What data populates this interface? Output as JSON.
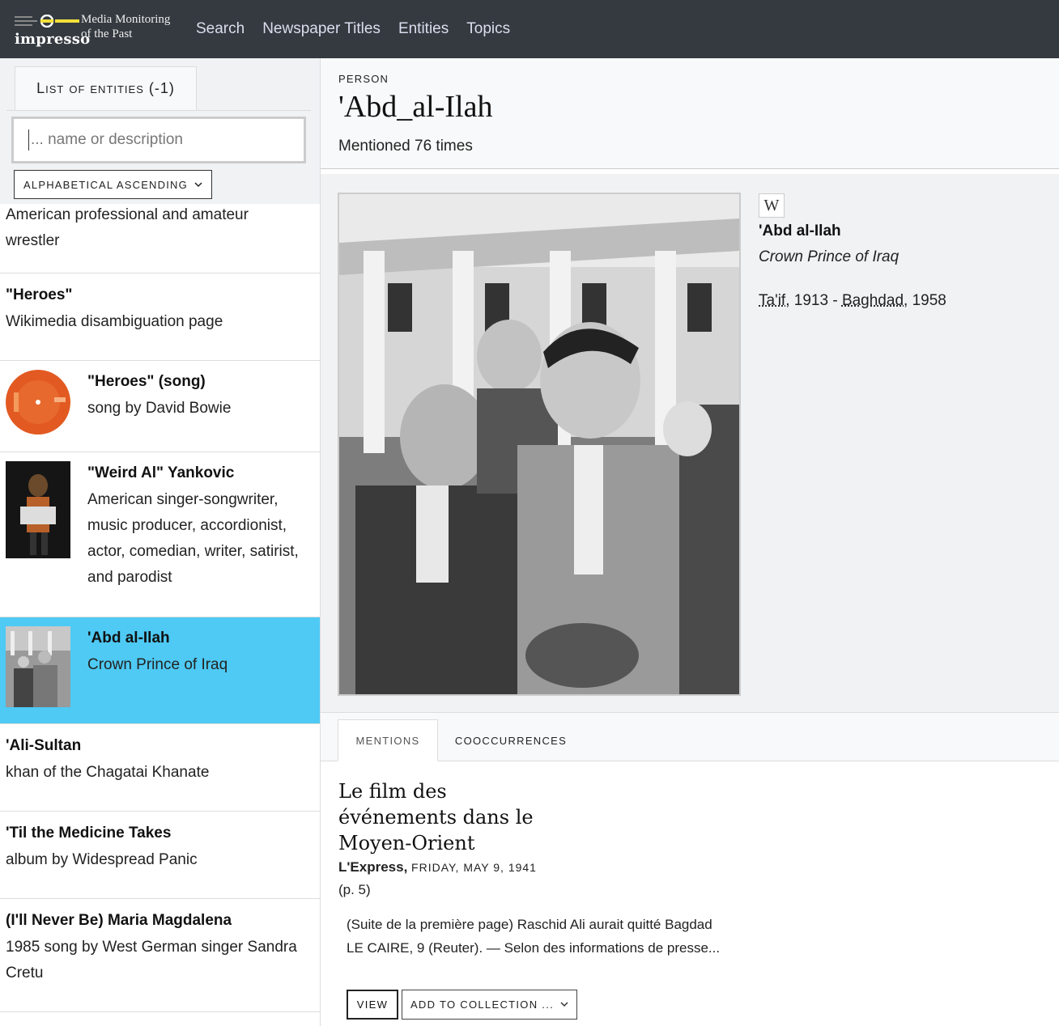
{
  "nav": {
    "brand_word": "impresso",
    "brand_tag_line1": "Media Monitoring",
    "brand_tag_line2": "of the Past",
    "links": [
      "Search",
      "Newspaper Titles",
      "Entities",
      "Topics"
    ]
  },
  "sidebar": {
    "tab_label": "List of entities (-1)",
    "search_placeholder": "... name or description",
    "sort_label": "ALPHABETICAL ASCENDING",
    "items": [
      {
        "name": "",
        "desc": "American professional and amateur wrestler"
      },
      {
        "name": "\"Heroes\"",
        "desc": "Wikimedia disambiguation page"
      },
      {
        "name": "\"Heroes\" (song)",
        "desc": "song by David Bowie"
      },
      {
        "name": "\"Weird Al\" Yankovic",
        "desc": "American singer-songwriter, music producer, accordionist, actor, comedian, writer, satirist, and parodist"
      },
      {
        "name": "'Abd al-Ilah",
        "desc": "Crown Prince of Iraq"
      },
      {
        "name": "'Ali-Sultan",
        "desc": "khan of the Chagatai Khanate"
      },
      {
        "name": "'Til the Medicine Takes",
        "desc": "album by Widespread Panic"
      },
      {
        "name": "(I'll Never Be) Maria Magdalena",
        "desc": "1985 song by West German singer Sandra Cretu"
      }
    ]
  },
  "entity": {
    "kind": "PERSON",
    "title": "'Abd_al-Ilah",
    "mentioned": "Mentioned 76 times",
    "wiki_icon": "W",
    "wiki_name": "'Abd al-Ilah",
    "wiki_desc": "Crown Prince of Iraq",
    "birth_place": "Ta'if",
    "birth_year": "1913",
    "death_place": "Baghdad",
    "death_year": "1958"
  },
  "tabs": {
    "mentions": "MENTIONS",
    "cooccurrences": "COOCCURRENCES"
  },
  "article": {
    "title": "Le film des événements dans le Moyen-Orient",
    "newspaper": "L'Express,",
    "date": "FRIDAY, MAY 9, 1941",
    "page": "(p. 5)",
    "excerpt": "(Suite de la première page) Raschid Ali aurait quitté Bagdad LE CAIRE, 9 (Reuter). — Selon des informations de presse...",
    "view_label": "VIEW",
    "add_label": "ADD TO COLLECTION ..."
  },
  "colors": {
    "navbar": "#343a40",
    "active_item": "#4ecaf4"
  }
}
